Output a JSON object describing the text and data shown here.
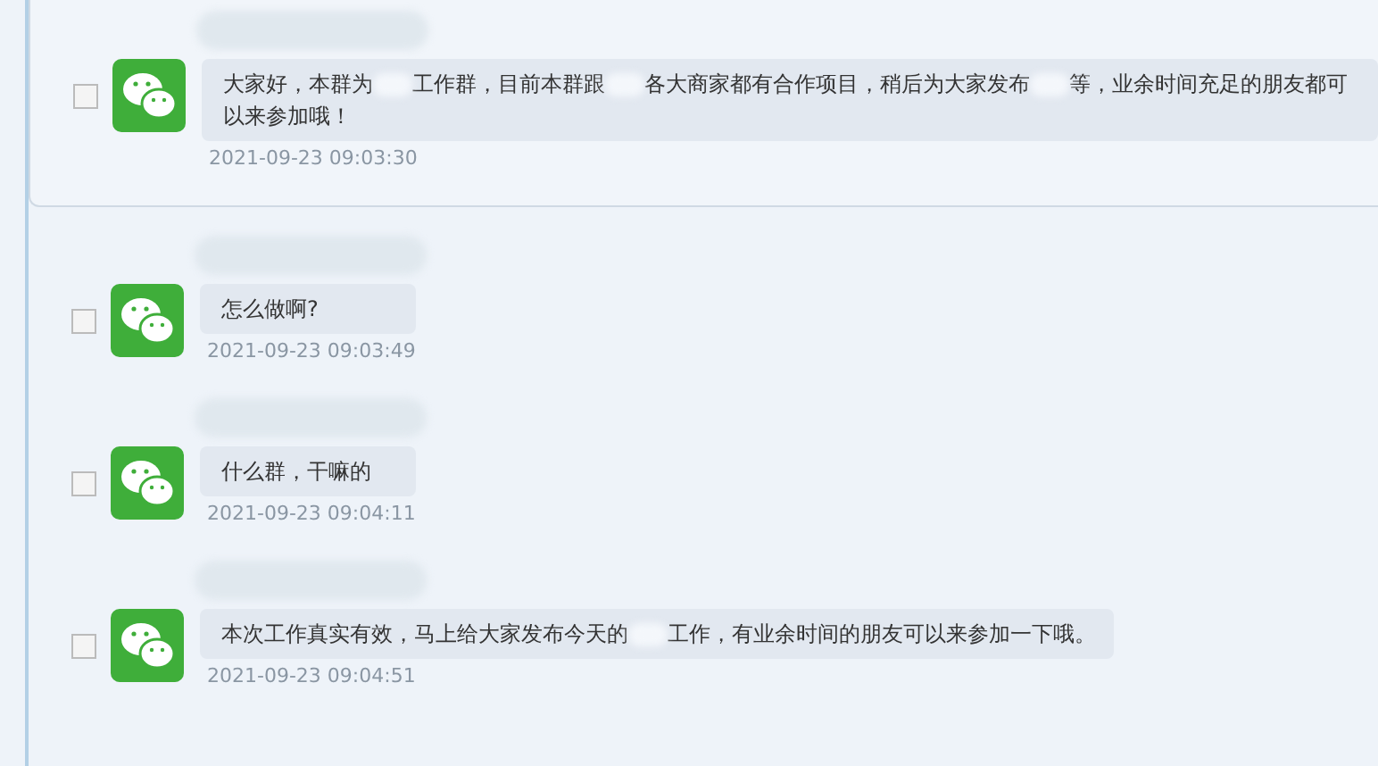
{
  "messages": [
    {
      "checked": false,
      "in_card": true,
      "segments": [
        {
          "kind": "text",
          "text": "大家好，本群为"
        },
        {
          "kind": "blur"
        },
        {
          "kind": "text",
          "text": "工作群，目前本群跟"
        },
        {
          "kind": "blur"
        },
        {
          "kind": "text",
          "text": "各大商家都有合作项目，稍后为大家发布"
        },
        {
          "kind": "blur"
        },
        {
          "kind": "text",
          "text": "等，业余时间充足的朋友都可以来参加哦！"
        }
      ],
      "time": "2021-09-23 09:03:30"
    },
    {
      "checked": false,
      "in_card": false,
      "segments": [
        {
          "kind": "text",
          "text": "怎么做啊?"
        }
      ],
      "time": "2021-09-23 09:03:49"
    },
    {
      "checked": false,
      "in_card": false,
      "segments": [
        {
          "kind": "text",
          "text": "什么群，干嘛的"
        }
      ],
      "time": "2021-09-23 09:04:11"
    },
    {
      "checked": false,
      "in_card": false,
      "segments": [
        {
          "kind": "text",
          "text": "本次工作真实有效，马上给大家发布今天的"
        },
        {
          "kind": "blur"
        },
        {
          "kind": "text",
          "text": "工作，有业余时间的朋友可以来参加一下哦。"
        }
      ],
      "time": "2021-09-23 09:04:51"
    }
  ]
}
